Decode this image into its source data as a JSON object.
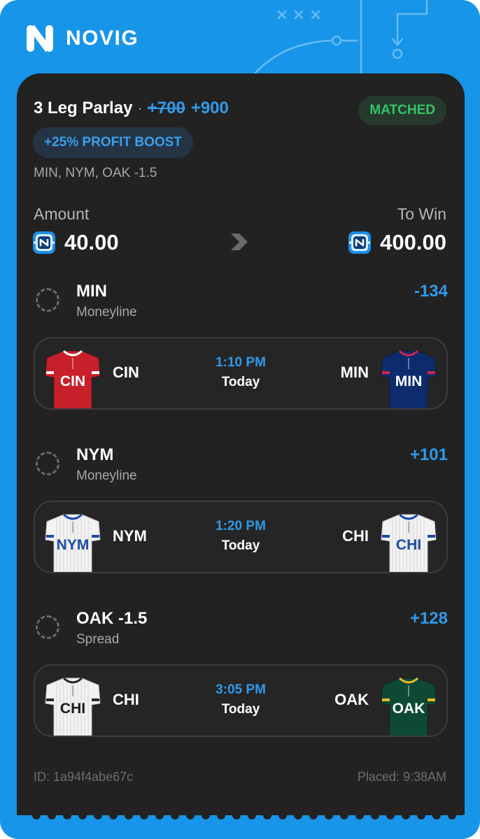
{
  "brand": {
    "name": "NOVIG"
  },
  "bet": {
    "title": "3 Leg Parlay",
    "separator": "·",
    "original_odds": "+700",
    "boosted_odds": "+900",
    "status": "MATCHED",
    "boost_label": "+25% PROFIT BOOST",
    "legs_summary": "MIN, NYM, OAK -1.5",
    "amount_label": "Amount",
    "amount": "40.00",
    "to_win_label": "To Win",
    "to_win": "400.00",
    "id": "ID: 1a94f4abe67c",
    "placed": "Placed: 9:38AM"
  },
  "legs": [
    {
      "team": "MIN",
      "type": "Moneyline",
      "odds": "-134",
      "game": {
        "away": "CIN",
        "home": "MIN",
        "time": "1:10 PM",
        "day": "Today",
        "away_jersey": {
          "text": "CIN",
          "color": "#c8202b",
          "text_color": "#ffffff",
          "trim": "#ffffff"
        },
        "home_jersey": {
          "text": "MIN",
          "color": "#0c2c6e",
          "text_color": "#ffffff",
          "trim": "#d3234a"
        }
      }
    },
    {
      "team": "NYM",
      "type": "Moneyline",
      "odds": "+101",
      "game": {
        "away": "NYM",
        "home": "CHI",
        "time": "1:20 PM",
        "day": "Today",
        "away_jersey": {
          "text": "NYM",
          "color": "#f2f2f2",
          "text_color": "#1d4aa8",
          "trim": "#1d4aa8"
        },
        "home_jersey": {
          "text": "CHI",
          "color": "#f2f2f2",
          "text_color": "#1d4aa8",
          "trim": "#1d4aa8"
        }
      }
    },
    {
      "team": "OAK -1.5",
      "type": "Spread",
      "odds": "+128",
      "game": {
        "away": "CHI",
        "home": "OAK",
        "time": "3:05 PM",
        "day": "Today",
        "away_jersey": {
          "text": "CHI",
          "color": "#f2f2f2",
          "text_color": "#1a1a1a",
          "trim": "#2a2a2a"
        },
        "home_jersey": {
          "text": "OAK",
          "color": "#0e4a33",
          "text_color": "#ffffff",
          "trim": "#e5b829"
        }
      }
    }
  ],
  "colors": {
    "brand": "#1795e8",
    "card": "#222222",
    "accent": "#2f9ae9",
    "matched": "#35c467"
  }
}
